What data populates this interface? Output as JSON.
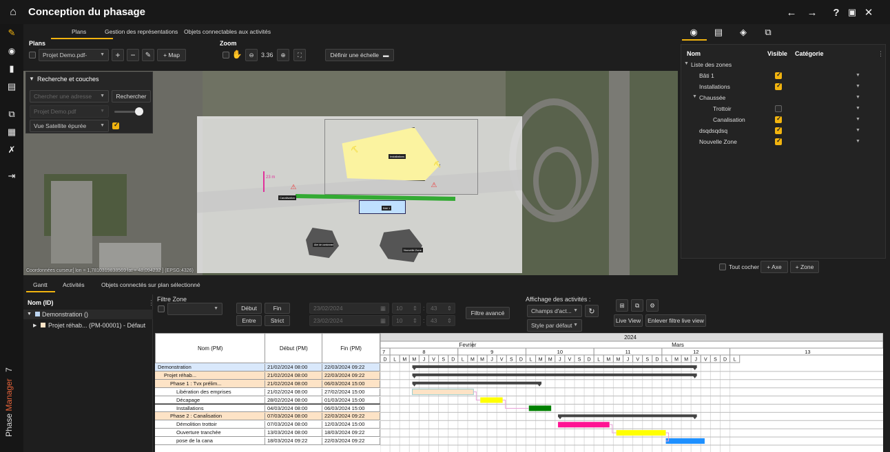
{
  "app": {
    "title": "Conception du phasage",
    "brand_phase": "Phase",
    "brand_manager": "Manager",
    "brand_version": "7"
  },
  "colors": {
    "accent": "#f2b40f",
    "selection": "#d9e8fb",
    "phase": "#fde3c6"
  },
  "left_nav": [
    "pencil-icon",
    "eye-icon",
    "book-icon",
    "printer-icon",
    "import-icon",
    "calendar-icon",
    "tools-icon",
    "exit-icon"
  ],
  "top_tabs": [
    {
      "label": "Plans"
    },
    {
      "label": "Gestion des représentations"
    },
    {
      "label": "Objets connectables aux activités"
    }
  ],
  "plans": {
    "heading": "Plans",
    "select_value": "Projet Demo.pdf-",
    "map_button": "+ Map"
  },
  "zoom": {
    "heading": "Zoom",
    "value": "3.36",
    "scale_button": "Définir une échelle"
  },
  "search_panel": {
    "title": "Recherche et couches",
    "address_placeholder": "Chercher une adresse",
    "search_button": "Rechercher",
    "layer_value": "Projet Demo.pdf",
    "background_value": "Vue Satellite épurée"
  },
  "map": {
    "labels": [
      "Installations",
      "Bâti 1",
      "Aire de cantonnement",
      "Nouvelle Zone",
      "Canalisation",
      "23 m"
    ],
    "coordinates": "Coordonnées curseur[ lon = 1,7810319838569 lat = 48,094232 ] (EPSG:4326)"
  },
  "zones": {
    "headers": {
      "name": "Nom",
      "visible": "Visible",
      "category": "Catégorie"
    },
    "rows": [
      {
        "label": "Liste des zones",
        "indent": 0,
        "tree": true,
        "checked": null
      },
      {
        "label": "Bâti 1",
        "indent": 1,
        "checked": true
      },
      {
        "label": "Installations",
        "indent": 1,
        "checked": true
      },
      {
        "label": "Chaussée",
        "indent": 0,
        "tree": true,
        "checked": null
      },
      {
        "label": "Trottoir",
        "indent": 2,
        "checked": false
      },
      {
        "label": "Canalisation",
        "indent": 2,
        "checked": true
      },
      {
        "label": "dsqdsqdsq",
        "indent": 1,
        "checked": true
      },
      {
        "label": "Nouvelle Zone",
        "indent": 1,
        "checked": true
      }
    ],
    "check_all": "Tout cocher",
    "add_axis": "+ Axe",
    "add_zone": "+ Zone"
  },
  "bottom_tabs": [
    {
      "label": "Gantt"
    },
    {
      "label": "Activités"
    },
    {
      "label": "Objets connectés sur plan sélectionné"
    }
  ],
  "tree": {
    "header": "Nom (ID)",
    "items": [
      {
        "label": "Demonstration ()"
      },
      {
        "label": "Projet réhab... (PM-00001) - Défaut"
      }
    ]
  },
  "filters": {
    "zone_label": "Filtre Zone",
    "debut": "Début",
    "fin": "Fin",
    "entre": "Entre",
    "strict": "Strict",
    "date1": "23/02/2024",
    "date2": "23/02/2024",
    "hour1": "10",
    "hour2": "10",
    "min1": "43",
    "min2": "43",
    "advanced": "Filtre avancé",
    "display_label": "Affichage des activités :",
    "fields_value": "Champs d'act...",
    "style_value": "Style par défaut",
    "live_view": "Live View",
    "remove_live": "Enlever filtre live view"
  },
  "gantt": {
    "col_name": "Nom (PM)",
    "col_start": "Début (PM)",
    "col_end": "Fin (PM)",
    "rows": [
      {
        "name": "Demonstration",
        "start": "21/02/2024 08:00",
        "end": "22/03/2024 09:22",
        "lvl": 0,
        "bg": "#d9e8fb"
      },
      {
        "name": "Projet réhab...",
        "start": "21/02/2024 08:00",
        "end": "22/03/2024 09:22",
        "lvl": 1,
        "bg": "#fde3c6"
      },
      {
        "name": "Phase 1 : Tvx prélim...",
        "start": "21/02/2024 08:00",
        "end": "06/03/2024 15:00",
        "lvl": 2,
        "bg": "#fde3c6"
      },
      {
        "name": "Libération des emprises",
        "start": "21/02/2024 08:00",
        "end": "27/02/2024 15:00",
        "lvl": 3,
        "bg": "#ffffff"
      },
      {
        "name": "Décapage",
        "start": "28/02/2024 08:00",
        "end": "01/03/2024 15:00",
        "lvl": 3,
        "bg": "#ffffff"
      },
      {
        "name": "Installations",
        "start": "04/03/2024 08:00",
        "end": "06/03/2024 15:00",
        "lvl": 3,
        "bg": "#ffffff"
      },
      {
        "name": "Phase 2 : Canalisation",
        "start": "07/03/2024 08:00",
        "end": "22/03/2024 09:22",
        "lvl": 2,
        "bg": "#fde3c6"
      },
      {
        "name": "Démolition trottoir",
        "start": "07/03/2024 08:00",
        "end": "12/03/2024 15:00",
        "lvl": 3,
        "bg": "#ffffff"
      },
      {
        "name": "Ouverture tranchée",
        "start": "13/03/2024 08:00",
        "end": "18/03/2024 09:22",
        "lvl": 3,
        "bg": "#ffffff"
      },
      {
        "name": "pose de la cana",
        "start": "18/03/2024 09:22",
        "end": "22/03/2024 09:22",
        "lvl": 3,
        "bg": "#ffffff"
      }
    ],
    "year": "2024",
    "months": [
      "Fevrier",
      "Mars"
    ],
    "weeks": [
      "7",
      "8",
      "9",
      "10",
      "11",
      "12",
      "13"
    ],
    "day_letters": [
      "D",
      "L",
      "M",
      "M",
      "J",
      "V",
      "S",
      "D",
      "L",
      "M",
      "M",
      "J",
      "V",
      "S",
      "D",
      "L",
      "M",
      "M",
      "J",
      "V",
      "S",
      "D",
      "L",
      "M",
      "M",
      "J",
      "V",
      "S",
      "D",
      "L",
      "M",
      "M",
      "J",
      "V",
      "S",
      "D",
      "L"
    ],
    "bars": [
      {
        "start_day": 3.3,
        "end_day": 32.6,
        "color": "#444444",
        "summary": true
      },
      {
        "start_day": 3.3,
        "end_day": 32.6,
        "color": "#444444",
        "summary": true
      },
      {
        "start_day": 3.3,
        "end_day": 16.6,
        "color": "#444444",
        "summary": true
      },
      {
        "start_day": 3.3,
        "end_day": 9.6,
        "color": "#fde3c6",
        "summary": false
      },
      {
        "start_day": 10.3,
        "end_day": 12.6,
        "color": "#ffff00",
        "summary": false
      },
      {
        "start_day": 15.3,
        "end_day": 17.6,
        "color": "#008000",
        "summary": false
      },
      {
        "start_day": 18.3,
        "end_day": 32.6,
        "color": "#444444",
        "summary": true
      },
      {
        "start_day": 18.3,
        "end_day": 23.6,
        "color": "#ff1493",
        "summary": false
      },
      {
        "start_day": 24.3,
        "end_day": 29.4,
        "color": "#ffff00",
        "summary": false
      },
      {
        "start_day": 29.4,
        "end_day": 33.4,
        "color": "#1e90ff",
        "summary": false
      }
    ]
  }
}
